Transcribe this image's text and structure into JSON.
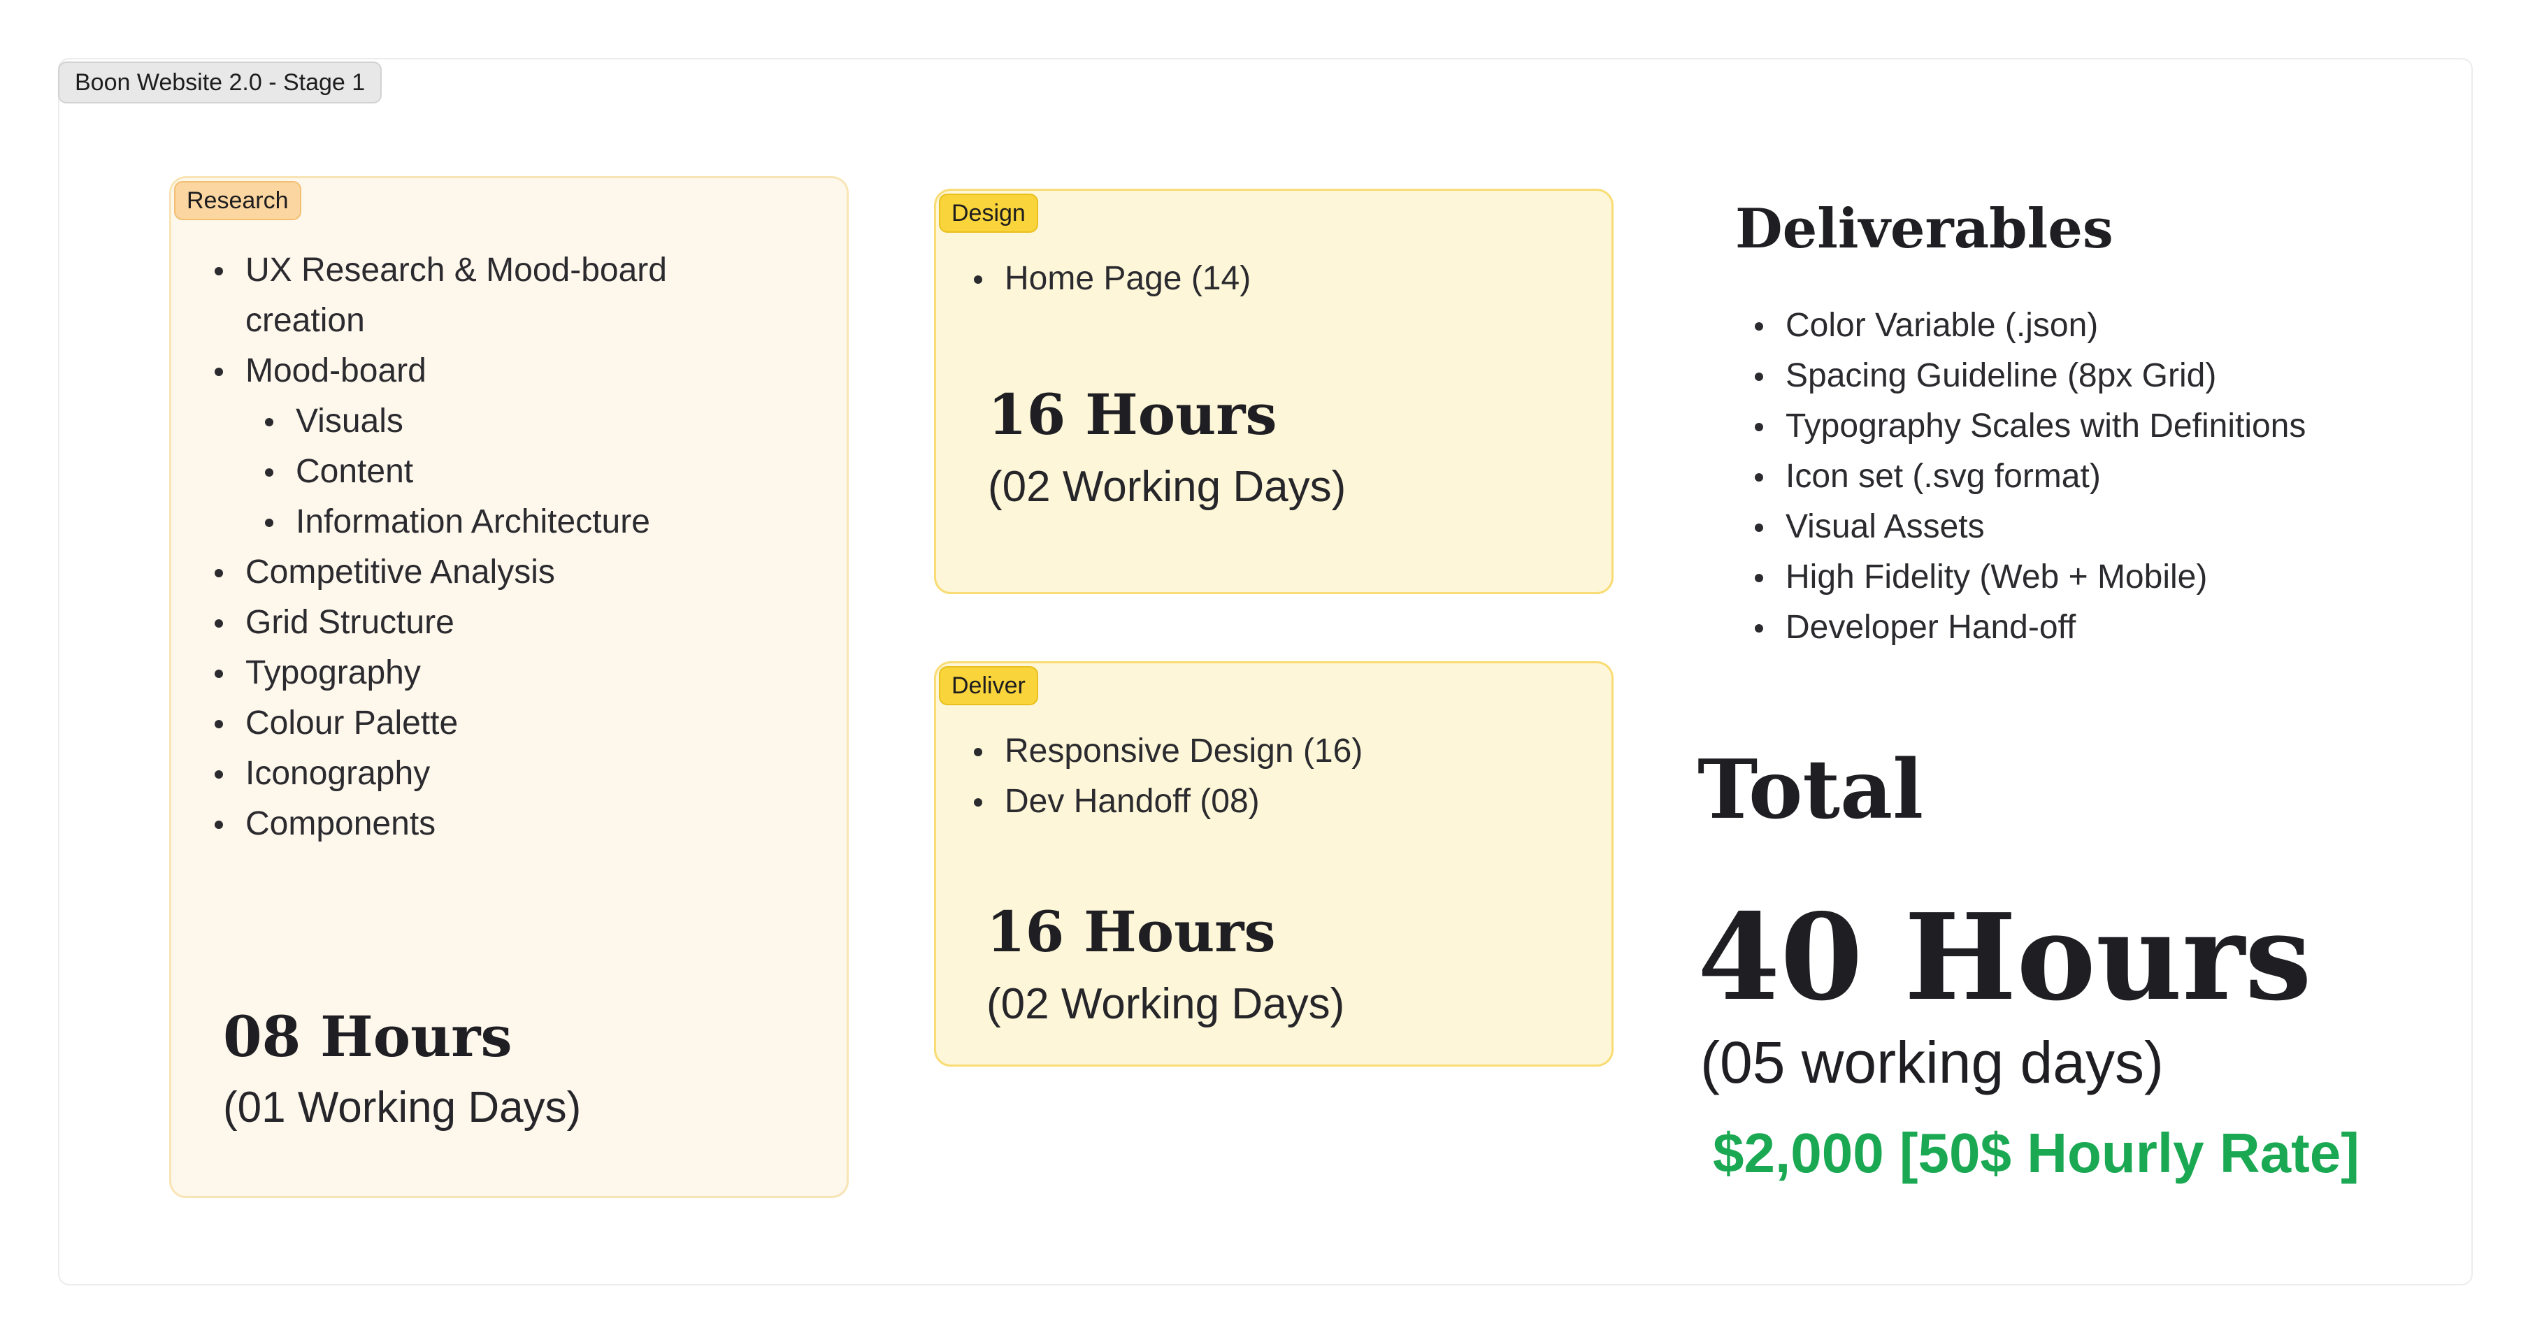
{
  "frame": {
    "title": "Boon Website 2.0 - Stage 1"
  },
  "research": {
    "tag": "Research",
    "items": [
      "UX Research & Mood-board",
      "creation",
      "Mood-board",
      "Visuals",
      "Content",
      "Information Architecture",
      "Competitive Analysis",
      "Grid Structure",
      "Typography",
      "Colour Palette",
      "Iconography",
      "Components"
    ],
    "hours": "08 Hours",
    "days": "(01 Working Days)"
  },
  "design": {
    "tag": "Design",
    "items": [
      "Home Page (14)"
    ],
    "hours": "16 Hours",
    "days": "(02 Working Days)"
  },
  "deliver": {
    "tag": "Deliver",
    "items": [
      "Responsive Design (16)",
      "Dev Handoff (08)"
    ],
    "hours": "16 Hours",
    "days": "(02 Working Days)"
  },
  "deliverables": {
    "heading": "Deliverables",
    "items": [
      "Color Variable (.json)",
      "Spacing Guideline (8px Grid)",
      "Typography Scales with Definitions",
      "Icon set (.svg format)",
      "Visual Assets",
      "High Fidelity  (Web + Mobile)",
      "Developer Hand-off"
    ]
  },
  "total": {
    "heading": "Total",
    "hours": "40 Hours",
    "days": "(05 working days)",
    "cost": "$2,000 [50$ Hourly Rate]"
  },
  "colors": {
    "research_bg": "#fef7ec",
    "research_tag": "#fbd6a0",
    "sticky_bg": "#fdf6d8",
    "sticky_tag": "#f9d43a",
    "cost_green": "#1aa853"
  }
}
